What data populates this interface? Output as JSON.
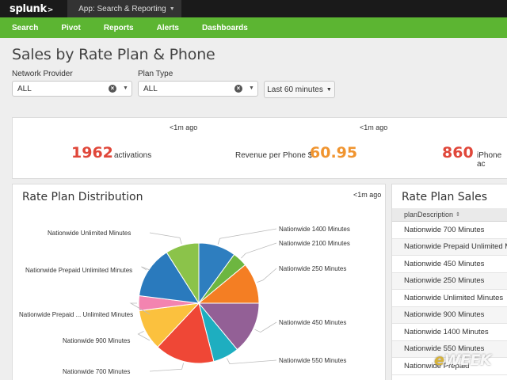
{
  "topbar": {
    "logo": "splunk",
    "logo_mark": ">",
    "app_menu": "App: Search & Reporting"
  },
  "nav": [
    "Search",
    "Pivot",
    "Reports",
    "Alerts",
    "Dashboards"
  ],
  "page_title": "Sales by Rate Plan & Phone",
  "filters": {
    "network_provider": {
      "label": "Network Provider",
      "value": "ALL"
    },
    "plan_type": {
      "label": "Plan Type",
      "value": "ALL"
    },
    "time_range": "Last 60 minutes"
  },
  "kpis": [
    {
      "ago": "<1m ago",
      "value": "1962",
      "label": "activations",
      "color": "#e0473a"
    },
    {
      "ago": "<1m ago",
      "value": "60.95",
      "label": "Revenue per Phone $",
      "color": "#f0942f"
    },
    {
      "ago": "",
      "value": "860",
      "label": "iPhone ac",
      "color": "#e0473a"
    }
  ],
  "distribution_panel": {
    "title": "Rate Plan Distribution",
    "ago": "<1m ago"
  },
  "chart_data": {
    "type": "pie",
    "title": "Rate Plan Distribution",
    "slices": [
      {
        "label": "Nationwide 1400 Minutes",
        "value": 10,
        "color": "#2e7ebf"
      },
      {
        "label": "Nationwide 2100 Minutes",
        "value": 4,
        "color": "#6db640"
      },
      {
        "label": "Nationwide 250 Minutes",
        "value": 11,
        "color": "#f47e23"
      },
      {
        "label": "Nationwide 450 Minutes",
        "value": 14,
        "color": "#936096"
      },
      {
        "label": "Nationwide 550 Minutes",
        "value": 7,
        "color": "#1eaec0"
      },
      {
        "label": "Nationwide 700 Minutes",
        "value": 16,
        "color": "#ef4736"
      },
      {
        "label": "Nationwide 900 Minutes",
        "value": 11,
        "color": "#fbc13e"
      },
      {
        "label": "Nationwide Prepaid ... Unlimited Minutes",
        "value": 4,
        "color": "#f384b0"
      },
      {
        "label": "Nationwide Prepaid Unlimited Minutes",
        "value": 14,
        "color": "#2a7abd"
      },
      {
        "label": "Nationwide Unlimited Minutes",
        "value": 9,
        "color": "#8bc34a"
      }
    ]
  },
  "sales_panel": {
    "title": "Rate Plan Sales",
    "column": "planDescription",
    "rows": [
      "Nationwide 700 Minutes",
      "Nationwide Prepaid Unlimited Mi",
      "Nationwide 450 Minutes",
      "Nationwide 250 Minutes",
      "Nationwide Unlimited Minutes",
      "Nationwide 900 Minutes",
      "Nationwide 1400 Minutes",
      "Nationwide 550 Minutes",
      "Nationwide Prepaid"
    ]
  },
  "watermark": {
    "mark": "e",
    "text": "WEEK"
  }
}
